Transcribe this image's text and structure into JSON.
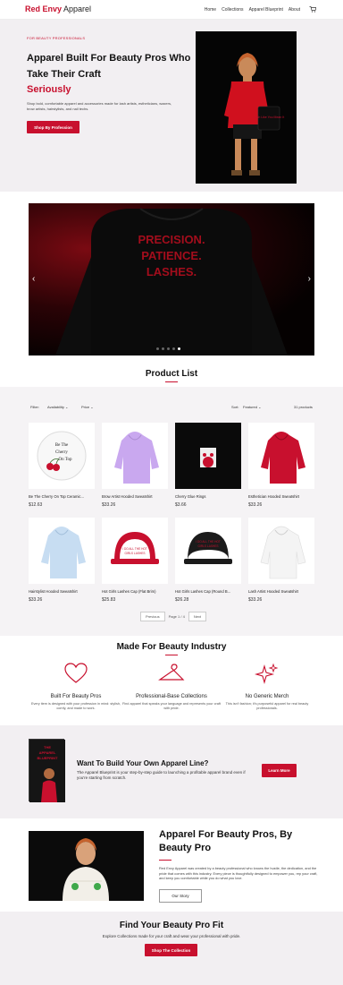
{
  "header": {
    "brand_red": "Red Envy",
    "brand_rest": " Apparel",
    "nav": [
      "Home",
      "Collections",
      "Apparel Blueprint",
      "About"
    ]
  },
  "hero": {
    "kicker": "FOR BEAUTY PROFESSIONALS",
    "title": "Apparel Built For Beauty Pros Who Take Their Craft",
    "accent": "Seriously",
    "desc": "Shop bold, comfortable apparel and accessories made for lash artists, estheticians, waxers, brow artists, hairstylists, and nail techs.",
    "button": "Shop By Profession",
    "bag_text": "Lash Like You Mean It"
  },
  "slider": {
    "slogan": [
      "PRECISION.",
      "PATIENCE.",
      "LASHES."
    ],
    "prev": "‹",
    "next": "›",
    "dots": 5,
    "active_dot": 4
  },
  "product_list": {
    "title": "Product List",
    "filter_label": "Filter:",
    "availability": "Availability",
    "price": "Price",
    "sort_label": "Sort:",
    "sort_value": "Featured",
    "count": "31 products",
    "products": [
      {
        "name": "Be The Cherry On Top Ceramic...",
        "price": "$12.63",
        "art": "cherry"
      },
      {
        "name": "Brow Artist Hooded Sweatshirt",
        "price": "$33.26",
        "art": "hoodie",
        "color": "#c9a8ef"
      },
      {
        "name": "Cherry Glue Rings",
        "price": "$3.66",
        "art": "rings"
      },
      {
        "name": "Esthetician Hooded Sweatshirt",
        "price": "$33.26",
        "art": "hoodie",
        "color": "#c8102e"
      },
      {
        "name": "Hairstylist Hooded Sweatshirt",
        "price": "$33.26",
        "art": "hoodie",
        "color": "#c7ddf2"
      },
      {
        "name": "Hot Girls Lashes Cap (Flat Brim)",
        "price": "$25.83",
        "art": "cap",
        "color": "#c8102e"
      },
      {
        "name": "Hot Girls Lashes Cap (Round B...",
        "price": "$26.28",
        "art": "cap",
        "color": "#1b1b1b"
      },
      {
        "name": "Lash Artist Hooded Sweatshirt",
        "price": "$33.26",
        "art": "hoodie",
        "color": "#f4f4f4"
      }
    ],
    "mug_text": [
      "Be The",
      "Cherry",
      "On Top"
    ],
    "cap_text": [
      "I DO ALL THE HOT",
      "GIRLS LASHES"
    ],
    "pager": {
      "prev": "Previous",
      "page": "Page 1 / 4",
      "next": "Next"
    }
  },
  "features": {
    "title": "Made For Beauty Industry",
    "items": [
      {
        "title": "Built For Beauty Pros",
        "desc": "Every item is designed with your profession in mind: stylish, comfy, and made to work."
      },
      {
        "title": "Professional-Base Collections",
        "desc": "Find apparel that speaks your language and represents your craft with pride."
      },
      {
        "title": "No Generic Merch",
        "desc": "This isn't fashion; it's purposeful apparel for real beauty professionals."
      }
    ]
  },
  "blueprint": {
    "book_title": [
      "THE",
      "APPAREL",
      "BLUEPRINT"
    ],
    "title": "Want To Build Your Own Apparel Line?",
    "desc": "The Apparel Blueprint is your step-by-step guide to launching a profitable apparel brand even if you're starting from scratch.",
    "button": "Learn More"
  },
  "story": {
    "title": "Apparel For Beauty Pros, By Beauty Pro",
    "desc": "Red Envy Apparel was created by a beauty professional who knows the hustle, the dedication, and the pride that comes with this industry. Every piece is thoughtfully designed to empower you, rep your craft, and keep you comfortable while you do what you love.",
    "button": "Our Story"
  },
  "bottom": {
    "title": "Find Your Beauty Pro Fit",
    "desc": "Explore Collections made for your craft and wear your professional with pride.",
    "button": "Shop The Collection"
  },
  "colors": {
    "accent": "#c8102e",
    "hero_bg": "#f2eff2"
  }
}
